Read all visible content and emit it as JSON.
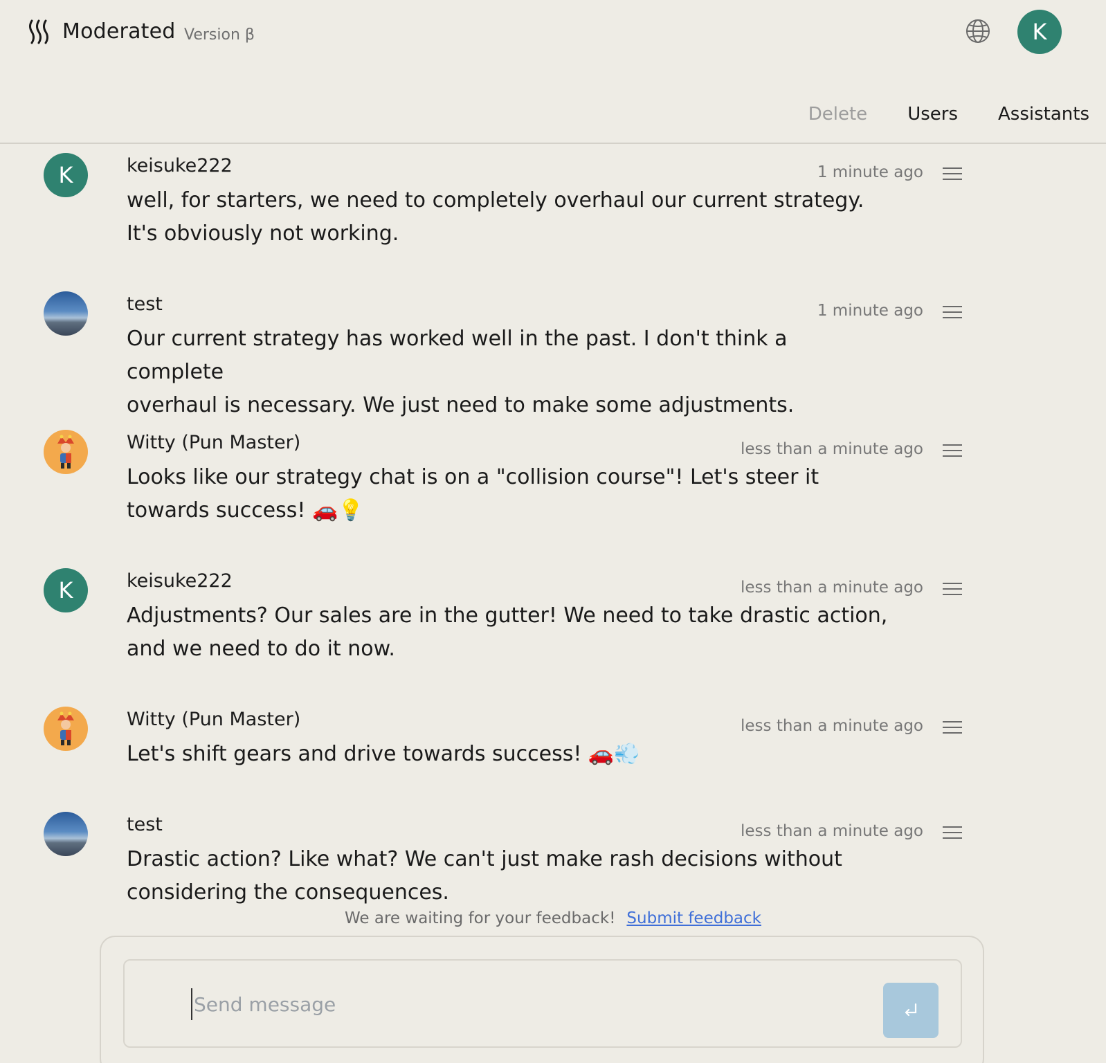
{
  "app": {
    "brand": "Moderated",
    "version": "Version β",
    "user_initial": "K",
    "accent": "#2f8270"
  },
  "toolbar": {
    "delete_label": "Delete",
    "users_label": "Users",
    "assistants_label": "Assistants"
  },
  "messages": [
    {
      "author": "keisuke222",
      "time": "1 minute ago",
      "avatar": "K",
      "avatar_type": "letter",
      "line1": "well, for starters, we need to completely overhaul our current strategy.",
      "line2": "It's obviously not working."
    },
    {
      "author": "test",
      "time": "1 minute ago",
      "avatar": "",
      "avatar_type": "photo",
      "line1": "Our current strategy has worked well in the past. I don't think a complete",
      "line2": "overhaul is necessary. We just need to make some adjustments."
    },
    {
      "author": "Witty (Pun Master)",
      "time": "less than a minute ago",
      "avatar": "",
      "avatar_type": "jester",
      "line1": "Looks like our strategy chat is on a \"collision course\"! Let's steer it",
      "line2": "towards success! 🚗💡"
    },
    {
      "author": "keisuke222",
      "time": "less than a minute ago",
      "avatar": "K",
      "avatar_type": "letter",
      "line1": "Adjustments? Our sales are in the gutter! We need to take drastic action,",
      "line2": "and we need to do it now."
    },
    {
      "author": "Witty (Pun Master)",
      "time": "less than a minute ago",
      "avatar": "",
      "avatar_type": "jester",
      "line1": "Let's shift gears and drive towards success! 🚗💨",
      "line2": ""
    },
    {
      "author": "test",
      "time": "less than a minute ago",
      "avatar": "",
      "avatar_type": "photo",
      "line1": "Drastic action? Like what? We can't just make rash decisions without",
      "line2": "considering the consequences."
    }
  ],
  "feedback": {
    "text": "We are waiting for your feedback!",
    "link": "Submit feedback"
  },
  "composer": {
    "placeholder": "Send message",
    "value": ""
  }
}
